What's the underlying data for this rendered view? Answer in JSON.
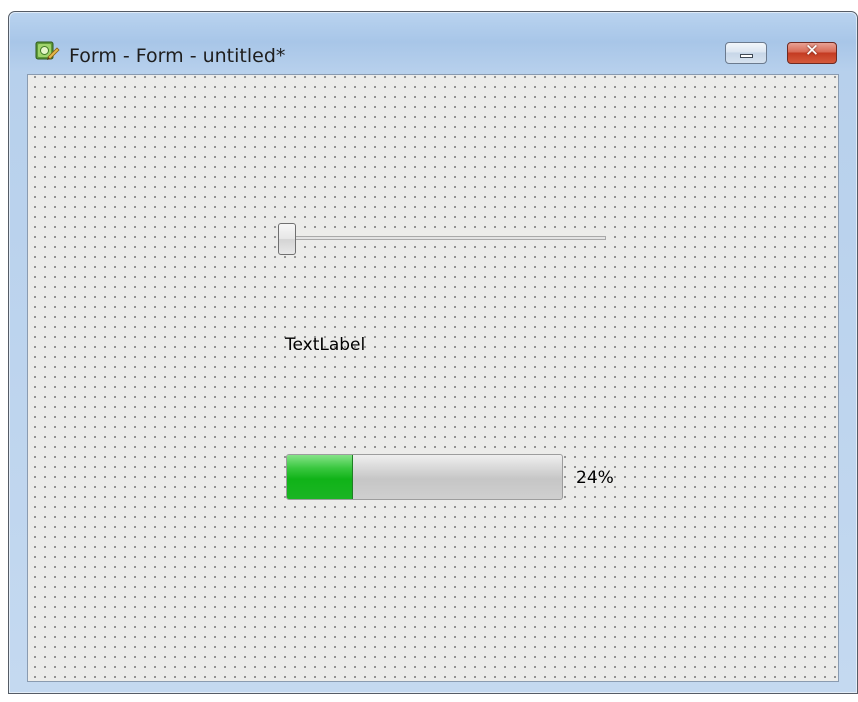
{
  "window": {
    "title": "Form - Form - untitled*",
    "icon": "qt-designer-form-icon",
    "minimize_icon": "minimize-icon",
    "close_icon": "close-icon",
    "close_glyph": "✕"
  },
  "form": {
    "slider": {
      "value_fraction": 0.0
    },
    "label": {
      "text": "TextLabel"
    },
    "progress": {
      "value_percent": 24,
      "text": "24%",
      "fill_color": "#10b318"
    }
  },
  "colors": {
    "close_button": "#c43b22",
    "titlebar": "#a8c6e8",
    "canvas": "#ececea"
  }
}
